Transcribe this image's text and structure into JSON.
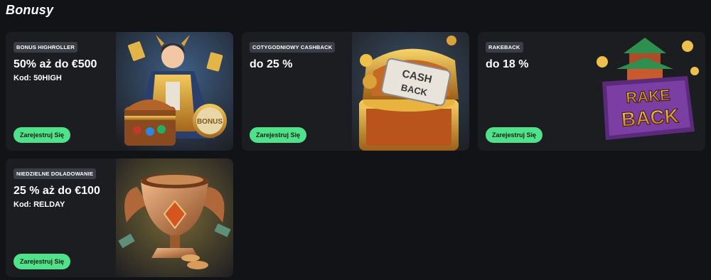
{
  "page": {
    "title": "Bonusy"
  },
  "cards": [
    {
      "badge": "BONUS HIGHROLLER",
      "offer": "50% aż do €500",
      "code": "Kod: 50HIGH",
      "cta": "Zarejestruj Się",
      "art_icon": "hero-with-treasure-chest-icon",
      "art_text": "BONUS"
    },
    {
      "badge": "COTYGODNIOWY CASHBACK",
      "offer": "do 25 %",
      "code": "",
      "cta": "Zarejestruj Się",
      "art_icon": "cashback-treasure-chest-icon",
      "art_text_1": "CASH",
      "art_text_2": "BACK"
    },
    {
      "badge": "RAKEBACK",
      "offer": "do 18 %",
      "code": "",
      "cta": "Zarejestruj Się",
      "art_icon": "rakeback-temple-logo-icon",
      "art_text_1": "RAKE",
      "art_text_2": "BACK"
    },
    {
      "badge": "NIEDZIELNE DOŁADOWANIE",
      "offer": "25 % aż do €100",
      "code": "Kod: RELDAY",
      "cta": "Zarejestruj Się",
      "art_icon": "golden-trophy-with-coins-icon"
    }
  ],
  "colors": {
    "background": "#121316",
    "card": "#1c1d21",
    "badge": "#3a3d45",
    "cta": "#4ee38b",
    "gold": "#d9a23a"
  }
}
